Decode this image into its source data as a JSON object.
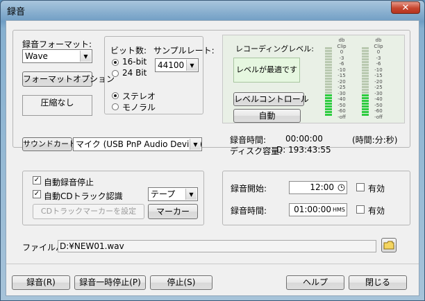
{
  "window": {
    "title": "録音",
    "close_glyph": "✕"
  },
  "format": {
    "label": "録音フォーマット:",
    "value": "Wave",
    "options_button": "フォーマットオプション",
    "compression": "圧縮なし"
  },
  "bits": {
    "label": "ビット数:",
    "opt16": "16-bit",
    "opt24": "24 Bit",
    "selected": "16-bit"
  },
  "sampling": {
    "label": "サンプルレート:",
    "value": "44100"
  },
  "channels": {
    "stereo": "ステレオ",
    "mono": "モノラル",
    "selected": "ステレオ"
  },
  "recording_level": {
    "label": "レコーディングレベル:",
    "status": "レベルが最適です",
    "level_control_button": "レベルコントロール",
    "auto_button": "自動",
    "meter_colors": {
      "green": "#2ecc40",
      "gray": "#b9c9b0",
      "panel": "#e6f7e0"
    }
  },
  "meter_scale": [
    "db",
    "Clip",
    "0",
    "-3",
    "-6",
    "-10",
    "-15",
    "-20",
    "-25",
    "-30",
    "-40",
    "-50",
    "-60",
    "-off"
  ],
  "sound_card": {
    "button": "サウンドカード:",
    "device": "マイク (USB PnP Audio Device)"
  },
  "info": {
    "time_label": "録音時間:",
    "time_value": "00:00:00",
    "time_unit": "(時間:分:秒)",
    "disk_label": "ディスク容量:",
    "disk_value": "D: 193:43:55"
  },
  "auto": {
    "auto_stop": "自動録音停止",
    "auto_stop_checked": true,
    "cd_track": "自動CDトラック認識",
    "cd_track_checked": true,
    "tape_value": "テープ",
    "cd_marker_button": "CDトラックマーカーを設定",
    "marker_button": "マーカー"
  },
  "schedule": {
    "start_label": "録音開始:",
    "start_value": "12:00",
    "start_enabled": "有効",
    "duration_label": "録音時間:",
    "duration_value": "01:00:00",
    "duration_unit": "HMS",
    "duration_enabled": "有効"
  },
  "file": {
    "label": "ファイルパス",
    "path": "D:¥NEW01.wav"
  },
  "buttons": {
    "record": "録音(R)",
    "pause": "録音一時停止(P)",
    "stop": "停止(S)",
    "help": "ヘルプ",
    "close": "閉じる"
  }
}
